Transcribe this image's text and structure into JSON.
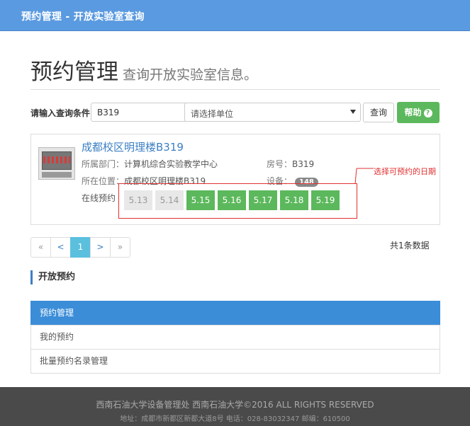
{
  "topbar": {
    "title": "预约管理 - 开放实验室查询"
  },
  "header": {
    "title": "预约管理",
    "subtitle": "查询开放实验室信息。"
  },
  "search": {
    "label": "请输入查询条件",
    "query_value": "B319",
    "unit_placeholder": "请选择单位",
    "query_button": "查询",
    "help_button": "帮助",
    "help_icon_glyph": "?"
  },
  "lab": {
    "name": "成都校区明理楼B319",
    "department_label": "所属部门：",
    "department": "计算机综合实验教学中心",
    "room_label": "房号：",
    "room": "B319",
    "location_label": "所在位置：",
    "location": "成都校区明理楼B319",
    "equipment_label": "设备：",
    "equipment_count": "148",
    "online_label": "在线预约",
    "dates": [
      {
        "label": "5.13",
        "available": false
      },
      {
        "label": "5.14",
        "available": false
      },
      {
        "label": "5.15",
        "available": true
      },
      {
        "label": "5.16",
        "available": true
      },
      {
        "label": "5.17",
        "available": true
      },
      {
        "label": "5.18",
        "available": true
      },
      {
        "label": "5.19",
        "available": true
      }
    ],
    "annotation": "选择可预约的日期"
  },
  "pager": {
    "first": "«",
    "prev": "<",
    "current": "1",
    "next": ">",
    "last": "»",
    "total": "共1条数据"
  },
  "section": {
    "title": "开放预约"
  },
  "menu": [
    {
      "label": "预约管理",
      "active": true
    },
    {
      "label": "我的预约",
      "active": false
    },
    {
      "label": "批量预约名录管理",
      "active": false
    }
  ],
  "footer": {
    "line1": "西南石油大学设备管理处 西南石油大学©2016 ALL RIGHTS RESERVED",
    "line2": "地址：成都市新都区新都大道8号 电话：028-83032347 邮编：610500"
  },
  "colors": {
    "topbar": "#5a9ae0",
    "accent": "#3b8dd8",
    "green": "#5cb85c",
    "callout": "#e03030"
  }
}
